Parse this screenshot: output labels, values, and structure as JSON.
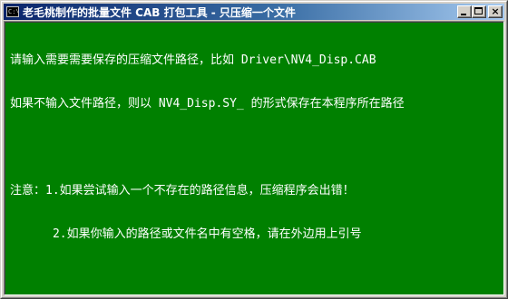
{
  "window": {
    "title": "老毛桃制作的批量文件 CAB 打包工具 - 只压缩一个文件",
    "icon_label": "C:\\",
    "buttons": {
      "minimize": "minimize-icon",
      "maximize": "maximize-icon",
      "close": "×"
    }
  },
  "console": {
    "background": "#008000",
    "foreground": "#ffffff",
    "lines": [
      "请输入需要需要保存的压缩文件路径，比如 Driver\\NV4_Disp.CAB",
      "如果不输入文件路径，则以 NV4_Disp.SY_ 的形式保存在本程序所在路径",
      "",
      "注意：1.如果尝试输入一个不存在的路径信息，压缩程序会出错！",
      "      2.如果你输入的路径或文件名中有空格，请在外边用上引号"
    ]
  }
}
